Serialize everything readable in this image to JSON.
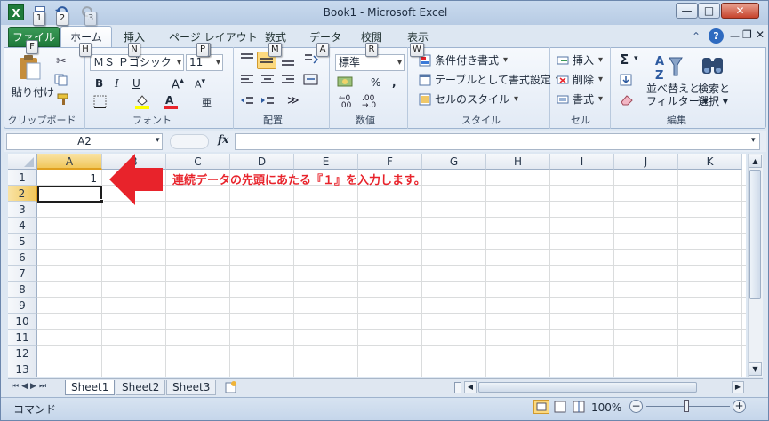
{
  "window": {
    "title": "Book1 - Microsoft Excel",
    "app_icon": "X",
    "min": "—",
    "max": "□",
    "close": "✕"
  },
  "qat_keytips": [
    "1",
    "2",
    "3"
  ],
  "tabs": {
    "file": "ファイル",
    "home": "ホーム",
    "insert": "挿入",
    "page_layout": "ページ レイアウト",
    "formulas": "数式",
    "data": "データ",
    "review": "校閲",
    "view": "表示"
  },
  "tab_keytips": {
    "file": "F",
    "home": "H",
    "insert": "N",
    "page_layout": "P",
    "formulas": "M",
    "data": "A",
    "review": "R",
    "view": "W"
  },
  "ribbon": {
    "clipboard": {
      "label": "クリップボード",
      "paste": "貼り付け"
    },
    "font": {
      "label": "フォント",
      "name": "ＭＳ Ｐゴシック",
      "size": "11",
      "bold": "B",
      "italic": "I",
      "underline": "U"
    },
    "alignment": {
      "label": "配置"
    },
    "number": {
      "label": "数値",
      "format": "標準",
      "percent": "%",
      "comma": ","
    },
    "styles": {
      "label": "スタイル",
      "conditional": "条件付き書式",
      "table": "テーブルとして書式設定",
      "cell_styles": "セルのスタイル"
    },
    "cells": {
      "label": "セル",
      "insert": "挿入",
      "delete": "削除",
      "format": "書式"
    },
    "editing": {
      "label": "編集",
      "sort": "並べ替えと",
      "sort2": "フィルター",
      "find": "検索と",
      "find2": "選択"
    }
  },
  "formula_bar": {
    "name_box": "A2",
    "fx": "fx",
    "value": ""
  },
  "columns": [
    "A",
    "B",
    "C",
    "D",
    "E",
    "F",
    "G",
    "H",
    "I",
    "J",
    "K"
  ],
  "rows": [
    "1",
    "2",
    "3",
    "4",
    "5",
    "6",
    "7",
    "8",
    "9",
    "10",
    "11",
    "12",
    "13"
  ],
  "cells": {
    "A1": "1"
  },
  "annotation": {
    "text": "連続データの先頭にあたる『１』を入力します。",
    "color": "#e8232b"
  },
  "sheets": [
    "Sheet1",
    "Sheet2",
    "Sheet3"
  ],
  "status": {
    "mode": "コマンド",
    "zoom": "100%"
  }
}
